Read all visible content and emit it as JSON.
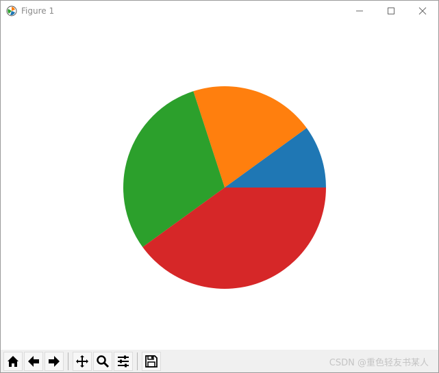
{
  "window": {
    "title": "Figure 1",
    "icon": "matplotlib-icon",
    "controls": [
      "minimize-icon",
      "maximize-icon",
      "close-icon"
    ]
  },
  "chart_data": {
    "type": "pie",
    "title": "",
    "values": [
      10,
      20,
      30,
      40
    ],
    "colors": [
      "#1f77b4",
      "#ff7f0e",
      "#2ca02c",
      "#d62728"
    ],
    "start_angle_deg": 0,
    "direction": "counterclockwise"
  },
  "toolbar": {
    "buttons": [
      "home-icon",
      "back-icon",
      "forward-icon",
      "pan-icon",
      "zoom-icon",
      "configure-subplots-icon",
      "save-icon"
    ]
  },
  "watermark": "CSDN @重色轻友书某人"
}
